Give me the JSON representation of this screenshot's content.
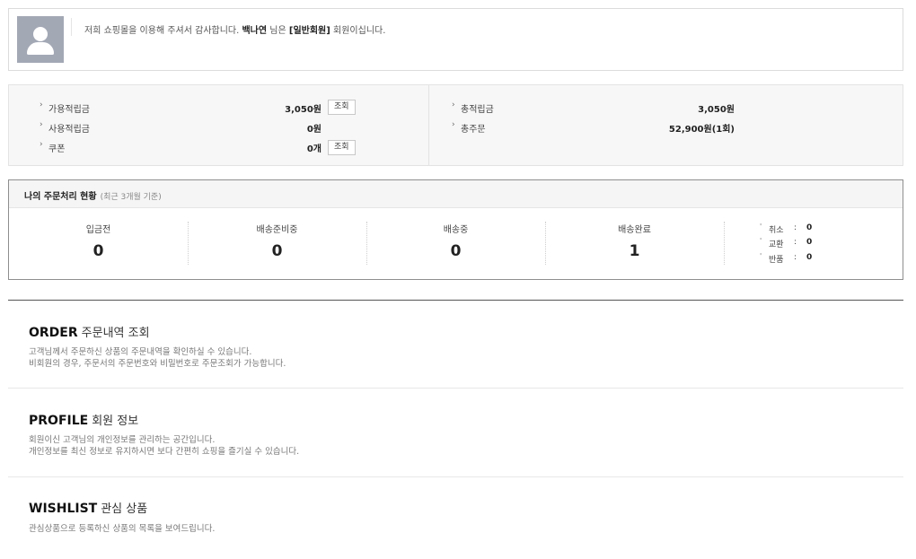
{
  "greeting": {
    "prefix": "저희 쇼핑몰을 이용해 주셔서 감사합니다.",
    "name": "백나연",
    "mid": "님은",
    "grade": "[일반회원]",
    "suffix": "회원이십니다."
  },
  "points": {
    "left": [
      {
        "label": "가용적립금",
        "value": "3,050원",
        "button": "조회"
      },
      {
        "label": "사용적립금",
        "value": "0원"
      },
      {
        "label": "쿠폰",
        "value": "0개",
        "button": "조회"
      }
    ],
    "right": [
      {
        "label": "총적립금",
        "value": "3,050원"
      },
      {
        "label": "총주문",
        "value": "52,900원(1회)"
      }
    ]
  },
  "order_status": {
    "title": "나의 주문처리 현황",
    "subtitle": "(최근 3개월 기준)",
    "stages": [
      {
        "label": "입금전",
        "count": "0"
      },
      {
        "label": "배송준비중",
        "count": "0"
      },
      {
        "label": "배송중",
        "count": "0"
      },
      {
        "label": "배송완료",
        "count": "1"
      }
    ],
    "others": [
      {
        "label": "취소",
        "colon": ":",
        "count": "0"
      },
      {
        "label": "교환",
        "colon": ":",
        "count": "0"
      },
      {
        "label": "반품",
        "colon": ":",
        "count": "0"
      }
    ]
  },
  "sections": {
    "order": {
      "title_en": "ORDER",
      "title_ko": "주문내역 조회",
      "desc1": "고객님께서 주문하신 상품의 주문내역을 확인하실 수 있습니다.",
      "desc2": "비회원의 경우, 주문서의 주문번호와 비밀번호로 주문조회가 가능합니다."
    },
    "profile": {
      "title_en": "PROFILE",
      "title_ko": "회원 정보",
      "desc1": "회원이신 고객님의 개인정보를 관리하는 공간입니다.",
      "desc2": "개인정보를 최신 정보로 유지하시면 보다 간편히 쇼핑을 즐기실 수 있습니다."
    },
    "wishlist": {
      "title_en": "WISHLIST",
      "title_ko": "관심 상품",
      "desc1": "관심상품으로 등록하신 상품의 목록을 보여드립니다."
    }
  }
}
